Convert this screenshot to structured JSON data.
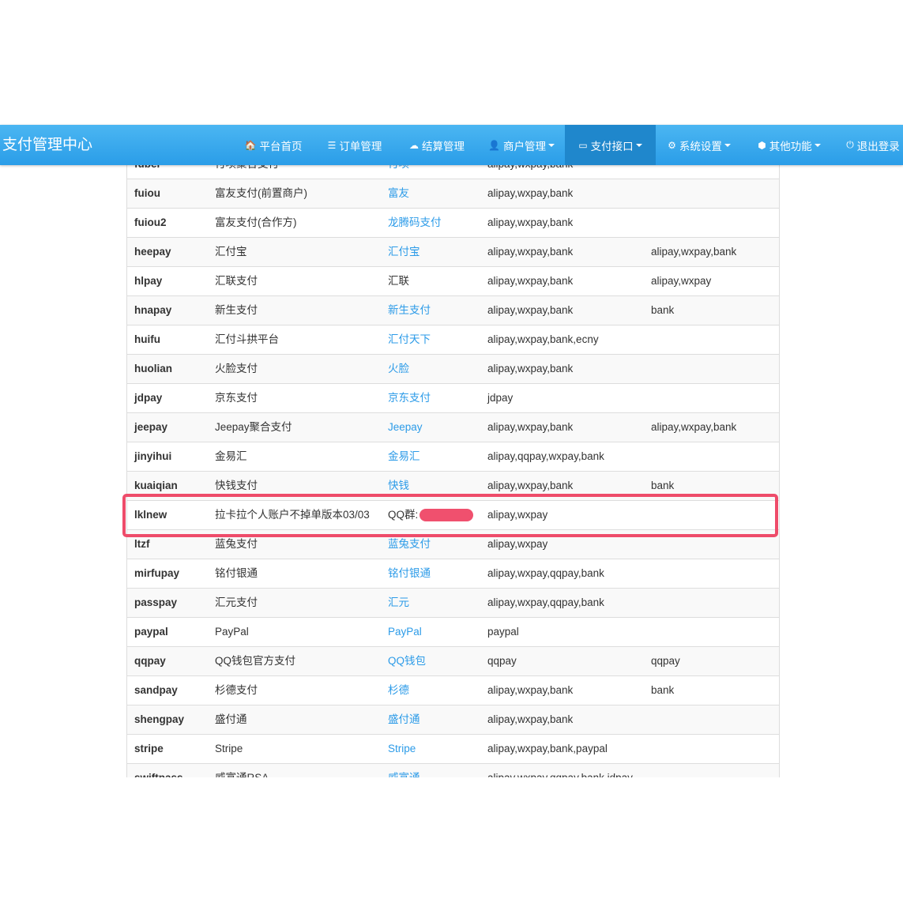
{
  "brand": "支付管理中心",
  "nav": [
    {
      "icon": "home-icon",
      "glyph": "🏠",
      "label": "平台首页",
      "dropdown": false,
      "active": false
    },
    {
      "icon": "list-icon",
      "glyph": "☰",
      "label": "订单管理",
      "dropdown": false,
      "active": false
    },
    {
      "icon": "cloud-icon",
      "glyph": "☁",
      "label": "结算管理",
      "dropdown": false,
      "active": false
    },
    {
      "icon": "user-icon",
      "glyph": "👤",
      "label": "商户管理",
      "dropdown": true,
      "active": false
    },
    {
      "icon": "credit-card-icon",
      "glyph": "▭",
      "label": "支付接口",
      "dropdown": true,
      "active": true
    },
    {
      "icon": "gear-icon",
      "glyph": "⚙",
      "label": "系统设置",
      "dropdown": true,
      "active": false
    },
    {
      "icon": "cube-icon",
      "glyph": "⬢",
      "label": "其他功能",
      "dropdown": true,
      "active": false
    },
    {
      "icon": "power-icon",
      "glyph": "⏻",
      "label": "退出登录",
      "dropdown": false,
      "active": false
    }
  ],
  "rows": [
    {
      "code": "fubei",
      "name": "付呗聚合支付",
      "link": "付呗",
      "link_colored": true,
      "types": "alipay,wxpay,bank",
      "extra": ""
    },
    {
      "code": "fuiou",
      "name": "富友支付(前置商户)",
      "link": "富友",
      "link_colored": true,
      "types": "alipay,wxpay,bank",
      "extra": ""
    },
    {
      "code": "fuiou2",
      "name": "富友支付(合作方)",
      "link": "龙腾码支付",
      "link_colored": true,
      "types": "alipay,wxpay,bank",
      "extra": ""
    },
    {
      "code": "heepay",
      "name": "汇付宝",
      "link": "汇付宝",
      "link_colored": true,
      "types": "alipay,wxpay,bank",
      "extra": "alipay,wxpay,bank"
    },
    {
      "code": "hlpay",
      "name": "汇联支付",
      "link": "汇联",
      "link_colored": false,
      "types": "alipay,wxpay,bank",
      "extra": "alipay,wxpay"
    },
    {
      "code": "hnapay",
      "name": "新生支付",
      "link": "新生支付",
      "link_colored": true,
      "types": "alipay,wxpay,bank",
      "extra": "bank"
    },
    {
      "code": "huifu",
      "name": "汇付斗拱平台",
      "link": "汇付天下",
      "link_colored": true,
      "types": "alipay,wxpay,bank,ecny",
      "extra": ""
    },
    {
      "code": "huolian",
      "name": "火脸支付",
      "link": "火脸",
      "link_colored": true,
      "types": "alipay,wxpay,bank",
      "extra": ""
    },
    {
      "code": "jdpay",
      "name": "京东支付",
      "link": "京东支付",
      "link_colored": true,
      "types": "jdpay",
      "extra": ""
    },
    {
      "code": "jeepay",
      "name": "Jeepay聚合支付",
      "link": "Jeepay",
      "link_colored": true,
      "types": "alipay,wxpay,bank",
      "extra": "alipay,wxpay,bank"
    },
    {
      "code": "jinyihui",
      "name": "金易汇",
      "link": "金易汇",
      "link_colored": true,
      "types": "alipay,qqpay,wxpay,bank",
      "extra": ""
    },
    {
      "code": "kuaiqian",
      "name": "快钱支付",
      "link": "快钱",
      "link_colored": true,
      "types": "alipay,wxpay,bank",
      "extra": "bank"
    },
    {
      "code": "lklnew",
      "name": "拉卡拉个人账户不掉单版本03/03",
      "link": "QQ群:",
      "link_colored": false,
      "redacted": true,
      "types": "alipay,wxpay",
      "extra": ""
    },
    {
      "code": "ltzf",
      "name": "蓝兔支付",
      "link": "蓝兔支付",
      "link_colored": true,
      "types": "alipay,wxpay",
      "extra": ""
    },
    {
      "code": "mirfupay",
      "name": "铭付银通",
      "link": "铭付银通",
      "link_colored": true,
      "types": "alipay,wxpay,qqpay,bank",
      "extra": ""
    },
    {
      "code": "passpay",
      "name": "汇元支付",
      "link": "汇元",
      "link_colored": true,
      "types": "alipay,wxpay,qqpay,bank",
      "extra": ""
    },
    {
      "code": "paypal",
      "name": "PayPal",
      "link": "PayPal",
      "link_colored": true,
      "types": "paypal",
      "extra": ""
    },
    {
      "code": "qqpay",
      "name": "QQ钱包官方支付",
      "link": "QQ钱包",
      "link_colored": true,
      "types": "qqpay",
      "extra": "qqpay"
    },
    {
      "code": "sandpay",
      "name": "杉德支付",
      "link": "杉德",
      "link_colored": true,
      "types": "alipay,wxpay,bank",
      "extra": "bank"
    },
    {
      "code": "shengpay",
      "name": "盛付通",
      "link": "盛付通",
      "link_colored": true,
      "types": "alipay,wxpay,bank",
      "extra": ""
    },
    {
      "code": "stripe",
      "name": "Stripe",
      "link": "Stripe",
      "link_colored": true,
      "types": "alipay,wxpay,bank,paypal",
      "extra": ""
    },
    {
      "code": "swiftpass",
      "name": "威富通RSA",
      "link": "威富通",
      "link_colored": true,
      "types": "alipay,wxpay,qqpay,bank,jdpay",
      "extra": ""
    }
  ],
  "colors": {
    "navbar": "#2a9de8",
    "active_nav": "#1f87cc",
    "link": "#2c9be8",
    "highlight": "#ee4c6a"
  }
}
